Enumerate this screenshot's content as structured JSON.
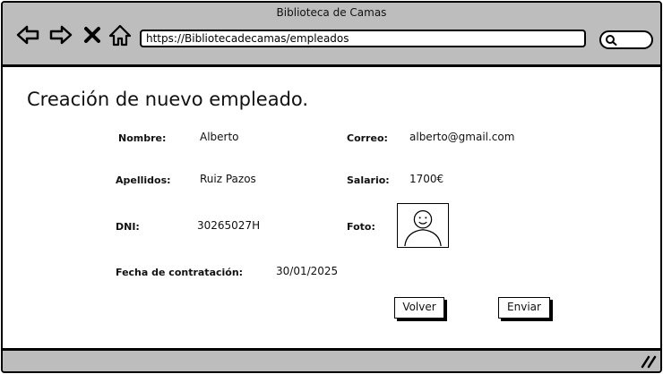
{
  "window": {
    "title": "Biblioteca de Camas"
  },
  "toolbar": {
    "url": "https://Bibliotecadecamas/empleados",
    "icons": [
      "back-arrow-icon",
      "forward-arrow-icon",
      "close-icon",
      "home-icon",
      "search-icon"
    ]
  },
  "form": {
    "title": "Creación de nuevo empleado.",
    "fields": {
      "nombre": {
        "label": "Nombre:",
        "value": "Alberto"
      },
      "correo": {
        "label": "Correo:",
        "value": "alberto@gmail.com"
      },
      "apellidos": {
        "label": "Apellidos:",
        "value": "Ruiz Pazos"
      },
      "salario": {
        "label": "Salario:",
        "value": "1700€"
      },
      "dni": {
        "label": "DNI:",
        "value": "30265027H"
      },
      "foto": {
        "label": "Foto:"
      },
      "fecha": {
        "label": "Fecha de contratación:",
        "value": "30/01/2025"
      }
    },
    "buttons": {
      "back_label": "Volver",
      "submit_label": "Enviar"
    }
  }
}
